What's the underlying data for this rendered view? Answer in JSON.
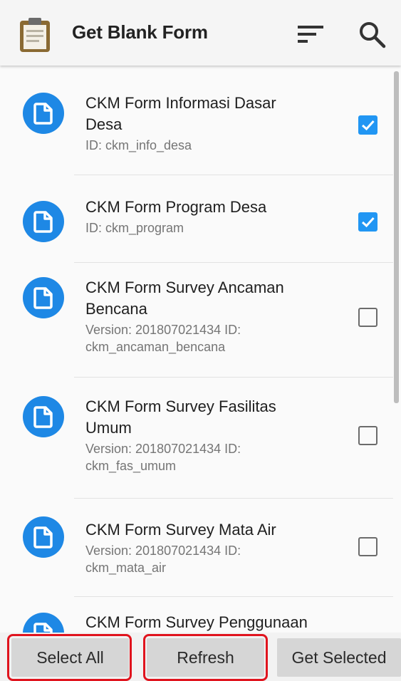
{
  "app_bar": {
    "title": "Get Blank Form",
    "app_icon": "clipboard-icon",
    "sort_icon": "sort-icon",
    "search_icon": "search-icon"
  },
  "forms": [
    {
      "title_lines": [
        "CKM Form Informasi Dasar",
        "Desa"
      ],
      "sub_lines": [
        "ID: ckm_info_desa"
      ],
      "checked": true
    },
    {
      "title_lines": [
        "CKM Form Program Desa"
      ],
      "sub_lines": [
        "ID: ckm_program"
      ],
      "checked": true
    },
    {
      "title_lines": [
        "CKM Form Survey Ancaman",
        "Bencana"
      ],
      "sub_lines": [
        "Version: 201807021434 ID:",
        "ckm_ancaman_bencana"
      ],
      "checked": false
    },
    {
      "title_lines": [
        "CKM Form Survey Fasilitas",
        "Umum"
      ],
      "sub_lines": [
        "Version: 201807021434 ID:",
        "ckm_fas_umum"
      ],
      "checked": false
    },
    {
      "title_lines": [
        "CKM Form Survey Mata Air"
      ],
      "sub_lines": [
        "Version: 201807021434 ID:",
        "ckm_mata_air"
      ],
      "checked": false
    },
    {
      "title_lines": [
        "CKM Form Survey Penggunaan"
      ],
      "sub_lines": [],
      "checked": false
    }
  ],
  "bottom_bar": {
    "select_all": "Select All",
    "refresh": "Refresh",
    "get_selected": "Get Selected"
  },
  "colors": {
    "accent": "#2196f3",
    "form_icon_bg": "#1e88e5",
    "highlight": "#e0141e"
  }
}
